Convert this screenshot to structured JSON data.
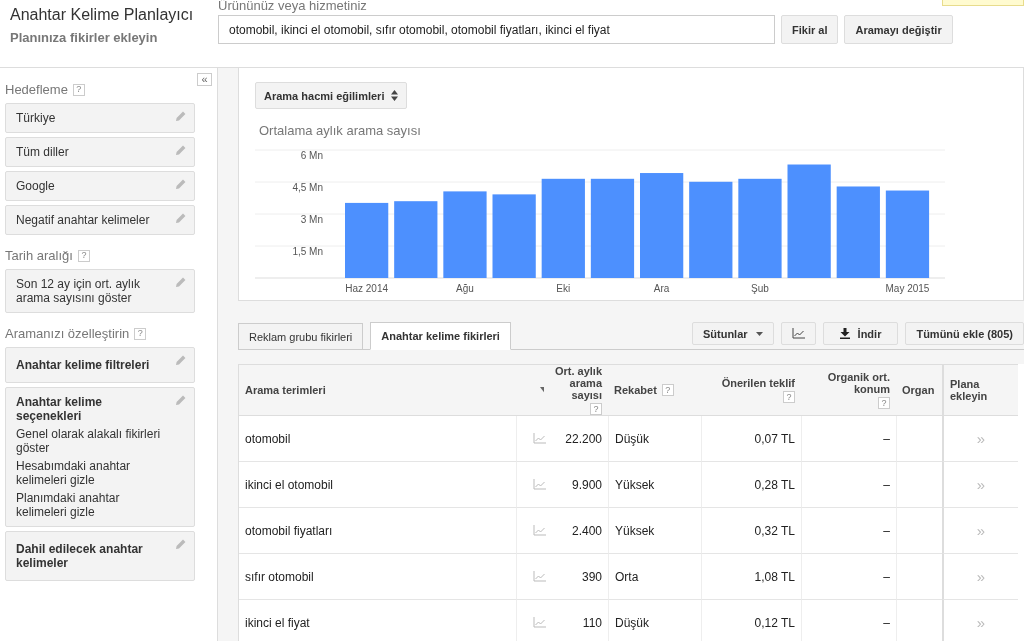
{
  "header": {
    "title": "Anahtar Kelime Planlayıcı",
    "subtitle": "Planınıza fikirler ekleyin",
    "search": {
      "label": "Ürününüz veya hizmetiniz",
      "value": "otomobil, ikinci el otomobil, sıfır otomobil, otomobil fiyatları, ikinci el fiyat"
    },
    "buttons": [
      "Fikir al",
      "Aramayı değiştir"
    ]
  },
  "sidebar": {
    "collapse": "«",
    "sections": [
      {
        "title": "Hedefleme",
        "help": "?",
        "items": [
          {
            "kind": "plain",
            "lines": [
              "Türkiye"
            ]
          },
          {
            "kind": "plain",
            "lines": [
              "Tüm diller"
            ]
          },
          {
            "kind": "plain",
            "lines": [
              "Google"
            ]
          },
          {
            "kind": "plain",
            "lines": [
              "Negatif anahtar kelimeler"
            ]
          }
        ]
      },
      {
        "title": "Tarih aralığı",
        "help": "?",
        "items": [
          {
            "kind": "plain",
            "lines": [
              "Son 12 ay için ort. aylık arama sayısını göster"
            ]
          }
        ]
      },
      {
        "title": "Aramanızı özelleştirin",
        "help": "?",
        "items": [
          {
            "kind": "heading",
            "lines": [
              "Anahtar kelime filtreleri"
            ]
          },
          {
            "kind": "heading",
            "lines": [
              "Anahtar kelime seçenekleri",
              "Genel olarak alakalı fikirleri göster",
              "Hesabımdaki anahtar kelimeleri gizle",
              "Planımdaki anahtar kelimeleri gizle"
            ]
          },
          {
            "kind": "heading",
            "lines": [
              "Dahil edilecek anahtar kelimeler"
            ]
          }
        ]
      }
    ]
  },
  "chart_panel": {
    "selector": "Arama hacmi eğilimleri",
    "chart_data": {
      "type": "bar",
      "title": "Ortalama aylık arama sayısı",
      "categories": [
        "Haz 2014",
        null,
        "Ağu",
        null,
        "Eki",
        null,
        "Ara",
        null,
        "Şub",
        null,
        null,
        "May 2015"
      ],
      "grid": true,
      "series": [
        {
          "color": "#4d90fe",
          "values": [
            3.52,
            3.6,
            4.06,
            3.92,
            4.65,
            4.65,
            4.92,
            4.51,
            4.65,
            5.32,
            4.29,
            4.1
          ]
        }
      ],
      "ylim": [
        0,
        6
      ],
      "yticks": [
        {
          "value": 1.5,
          "label": "1,5 Mn"
        },
        {
          "value": 3,
          "label": "3 Mn"
        },
        {
          "value": 4.5,
          "label": "4,5 Mn"
        },
        {
          "value": 6,
          "label": "6 Mn"
        }
      ]
    }
  },
  "tabs": [
    {
      "label": "Reklam grubu fikirleri",
      "selected": false
    },
    {
      "label": "Anahtar kelime fikirleri",
      "selected": true
    }
  ],
  "toolbar": {
    "columns": "Sütunlar",
    "download": "İndir",
    "add_all": "Tümünü ekle (805)"
  },
  "table": {
    "columns": [
      {
        "label": "Arama terimleri"
      },
      {
        "label": "Ort. aylık arama sayısı",
        "help": "?"
      },
      {
        "label": "Rekabet",
        "help": "?"
      },
      {
        "label": "Önerilen teklif",
        "help": "?"
      },
      {
        "label": "Organik ort. konum",
        "help": "?"
      },
      {
        "label": "Organ"
      },
      {
        "label": "Plana ekleyin"
      }
    ],
    "rows": [
      {
        "term": "otomobil",
        "searches": "22.200",
        "competition": "Düşük",
        "bid": "0,07 TL",
        "position": "–",
        "add": "»"
      },
      {
        "term": "ikinci el otomobil",
        "searches": "9.900",
        "competition": "Yüksek",
        "bid": "0,28 TL",
        "position": "–",
        "add": "»"
      },
      {
        "term": "otomobil fiyatları",
        "searches": "2.400",
        "competition": "Yüksek",
        "bid": "0,32 TL",
        "position": "–",
        "add": "»"
      },
      {
        "term": "sıfır otomobil",
        "searches": "390",
        "competition": "Orta",
        "bid": "1,08 TL",
        "position": "–",
        "add": "»"
      },
      {
        "term": "ikinci el fiyat",
        "searches": "110",
        "competition": "Düşük",
        "bid": "0,12 TL",
        "position": "–",
        "add": "»"
      }
    ]
  }
}
